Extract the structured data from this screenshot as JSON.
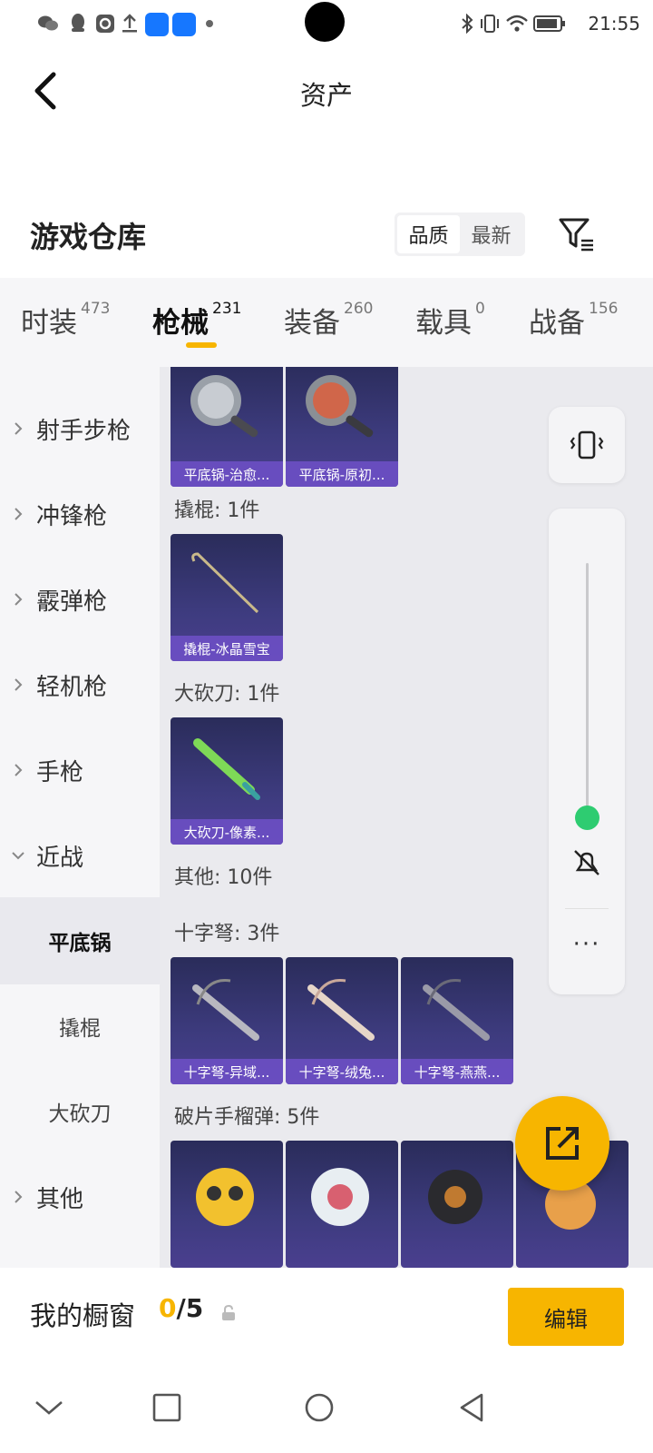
{
  "status_bar": {
    "time": "21:55",
    "icons": [
      "wechat-icon",
      "qq-icon",
      "q-app-icon",
      "upload-icon",
      "app-icon",
      "app-icon",
      "dot-icon",
      "bluetooth-icon",
      "vibrate-icon",
      "wifi-icon",
      "battery-icon"
    ]
  },
  "header": {
    "title": "资产"
  },
  "warehouse": {
    "title": "游戏仓库",
    "sort_options": [
      "品质",
      "最新"
    ],
    "sort_selected": "品质"
  },
  "tabs": [
    {
      "label": "时装",
      "count": "473",
      "active": false
    },
    {
      "label": "枪械",
      "count": "231",
      "active": true
    },
    {
      "label": "装备",
      "count": "260",
      "active": false
    },
    {
      "label": "载具",
      "count": "0",
      "active": false
    },
    {
      "label": "战备",
      "count": "156",
      "active": false
    }
  ],
  "sidebar": {
    "items": [
      {
        "label": "射手步枪",
        "expanded": false
      },
      {
        "label": "冲锋枪",
        "expanded": false
      },
      {
        "label": "霰弹枪",
        "expanded": false
      },
      {
        "label": "轻机枪",
        "expanded": false
      },
      {
        "label": "手枪",
        "expanded": false
      },
      {
        "label": "近战",
        "expanded": true
      },
      {
        "label": "平底锅",
        "sub": true,
        "active": true
      },
      {
        "label": "撬棍",
        "sub": true
      },
      {
        "label": "大砍刀",
        "sub": true
      },
      {
        "label": "其他",
        "expanded": false
      }
    ]
  },
  "content": {
    "top_cards": [
      "平底锅-治愈...",
      "平底锅-原初..."
    ],
    "groups": [
      {
        "label": "撬棍: 1件",
        "cards": [
          "撬棍-冰晶雪宝"
        ]
      },
      {
        "label": "大砍刀: 1件",
        "cards": [
          "大砍刀-像素..."
        ]
      },
      {
        "label": "其他: 10件",
        "cards": []
      },
      {
        "label": "十字弩: 3件",
        "cards": [
          "十字弩-异域...",
          "十字弩-绒兔...",
          "十字弩-燕燕..."
        ]
      },
      {
        "label": "破片手榴弹: 5件",
        "cards": []
      }
    ]
  },
  "floating": {
    "more": "···"
  },
  "bottom": {
    "showcase_label": "我的橱窗",
    "showcase_current": "0",
    "showcase_total": "/5",
    "edit_label": "编辑"
  },
  "colors": {
    "accent": "#f7b500",
    "card_bg": "#3d3b7e",
    "card_label": "#6e50c8",
    "knob": "#2ecc71"
  }
}
